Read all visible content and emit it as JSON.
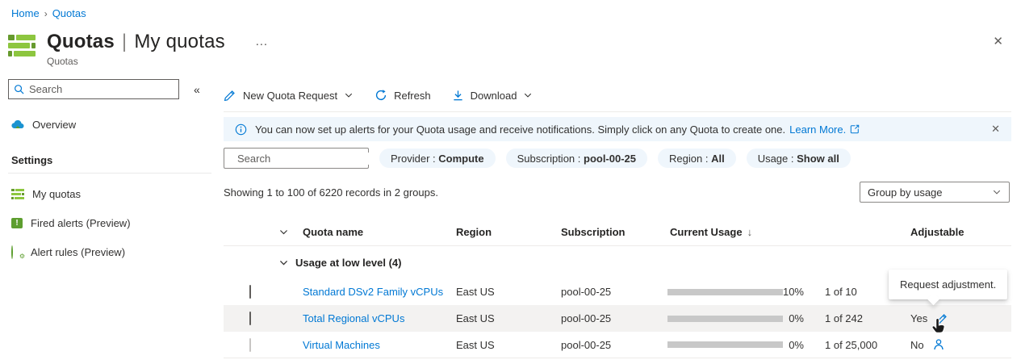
{
  "colors": {
    "accent": "#0078d4",
    "green_light": "#8dc63f",
    "green_dark": "#669a2e",
    "banner_bg": "#eff6fc",
    "row_hover": "#f3f2f1",
    "bar_track": "#c8c8c8",
    "bar_fill": "#0078d4"
  },
  "glyphs": {
    "breadcrumb_separator": "›",
    "collapse": "«",
    "ellipsis": "…",
    "close": "✕",
    "sort_desc": "↓",
    "exclamation": "!",
    "gear": "⚙"
  },
  "breadcrumb": {
    "home": "Home",
    "current": "Quotas"
  },
  "header": {
    "title": "Quotas",
    "separator": "|",
    "view_title": "My quotas",
    "resource_type": "Quotas"
  },
  "sidebar": {
    "search_placeholder": "Search",
    "overview": "Overview",
    "settings_header": "Settings",
    "my_quotas": "My quotas",
    "fired_alerts": "Fired alerts (Preview)",
    "alert_rules": "Alert rules (Preview)"
  },
  "toolbar": {
    "new_quota_request": "New Quota Request",
    "refresh": "Refresh",
    "download": "Download"
  },
  "banner": {
    "message": "You can now set up alerts for your Quota usage and receive notifications. Simply click on any Quota to create one.",
    "link": "Learn More."
  },
  "filters": {
    "search_placeholder": "Search",
    "pills": [
      {
        "name": "Provider",
        "separator": " : ",
        "value": "Compute"
      },
      {
        "name": "Subscription",
        "separator": " : ",
        "value": "pool-00-25"
      },
      {
        "name": "Region",
        "separator": " : ",
        "value": "All"
      },
      {
        "name": "Usage",
        "separator": " : ",
        "value": "Show all"
      }
    ]
  },
  "results": {
    "summary": "Showing 1 to 100 of 6220 records in 2 groups.",
    "group_by": "Group by usage"
  },
  "table": {
    "headers": {
      "quota_name": "Quota name",
      "region": "Region",
      "subscription": "Subscription",
      "current_usage": "Current Usage",
      "adjustable": "Adjustable"
    },
    "group_label": "Usage at low level (4)",
    "rows": [
      {
        "name": "Standard DSv2 Family vCPUs",
        "region": "East US",
        "subscription": "pool-00-25",
        "usage_percent": "10%",
        "usage_detail": "1 of 10",
        "adjustable": "",
        "bar_style": "width:15px"
      },
      {
        "name": "Total Regional vCPUs",
        "region": "East US",
        "subscription": "pool-00-25",
        "usage_percent": "0%",
        "usage_detail": "1 of 242",
        "adjustable": "Yes",
        "bar_style": "width:2px"
      },
      {
        "name": "Virtual Machines",
        "region": "East US",
        "subscription": "pool-00-25",
        "usage_percent": "0%",
        "usage_detail": "1 of 25,000",
        "adjustable": "No",
        "bar_style": "width:2px"
      }
    ]
  },
  "tooltip": {
    "text": "Request adjustment."
  }
}
